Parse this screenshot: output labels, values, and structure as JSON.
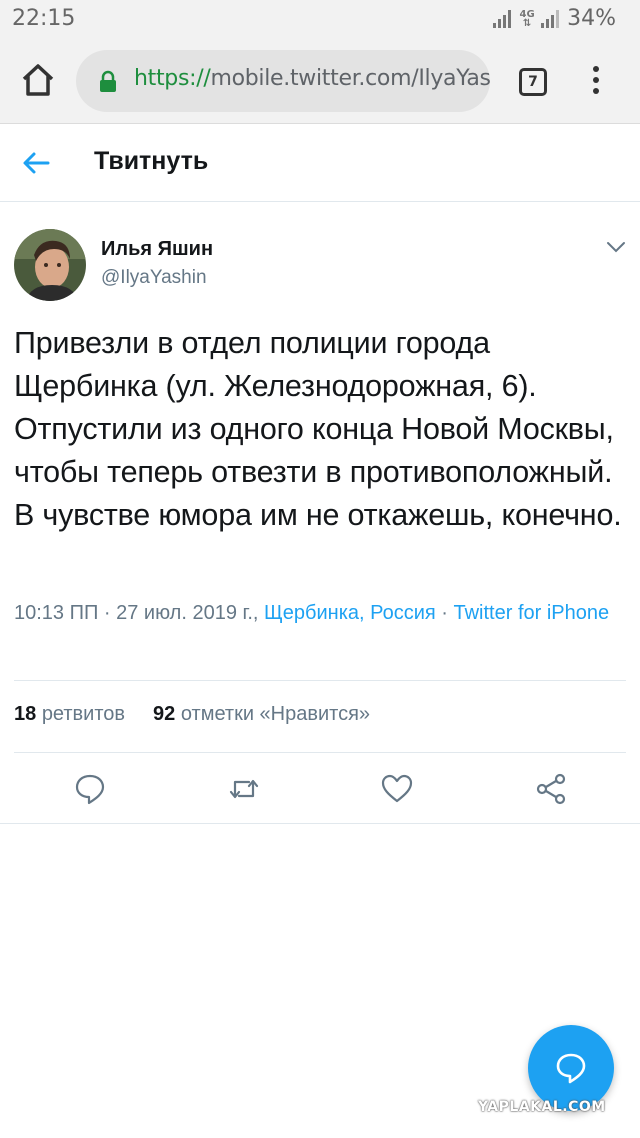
{
  "status_bar": {
    "time": "22:15",
    "network": "4G",
    "battery": "34%"
  },
  "browser": {
    "url_scheme": "https://",
    "url_rest": "mobile.twitter.com/IlyaYas",
    "tab_count": "7"
  },
  "header": {
    "title": "Твитнуть"
  },
  "tweet": {
    "author_name": "Илья Яшин",
    "author_handle": "@IlyaYashin",
    "text": "Привезли в отдел полиции города Щербинка (ул. Железнодорожная, 6). Отпустили из одного конца Новой Москвы, чтобы теперь отвезти в противоположный. В чувстве юмора им не откажешь, конечно.",
    "time_date": "10:13 ПП · 27 июл. 2019 г., ",
    "location": "Щербинка, Россия",
    "separator": " · ",
    "source": "Twitter for iPhone",
    "retweets_count": "18",
    "retweets_label": "ретвитов",
    "likes_count": "92",
    "likes_label": "отметки «Нравится»"
  },
  "actions": [
    "reply-icon",
    "retweet-icon",
    "like-icon",
    "share-icon"
  ],
  "colors": {
    "accent": "#1da1f2",
    "text": "#14171a",
    "secondary": "#657786",
    "secure": "#1e8e3e"
  },
  "watermark": "YAPLAKAL.COM"
}
